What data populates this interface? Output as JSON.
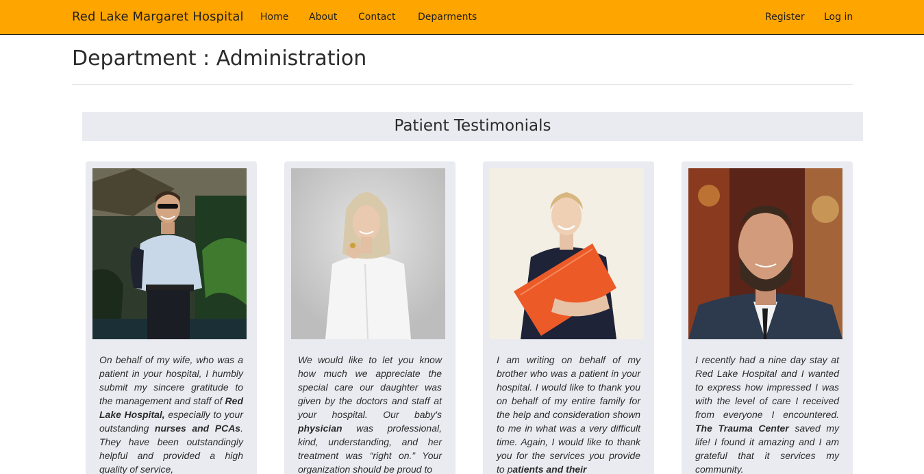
{
  "nav": {
    "brand": "Red Lake Margaret Hospital",
    "links": [
      "Home",
      "About",
      "Contact",
      "Deparments"
    ],
    "register": "Register",
    "login": "Log in"
  },
  "page": {
    "title": "Department : Administration"
  },
  "testimonials": {
    "heading": "Patient Testimonials",
    "cards": [
      {
        "parts": [
          "On behalf of my wife, who was a patient in your hospital, I humbly submit my sincere gratitude to the management and staff of ",
          "Red Lake Hospital,",
          " especially to your outstanding ",
          "nurses and PCAs",
          ". They have been outstandingly helpful and provided a high quality of service,"
        ]
      },
      {
        "parts": [
          "We would like to let you know how much we appreciate the special care our daughter was given by the doctors and staff at your hospital. Our baby's ",
          "physician",
          " was professional, kind, understanding, and her treatment was “right on.” Your organization should be proud to"
        ]
      },
      {
        "parts": [
          "I am writing on behalf of my brother who was a patient in your hospital. I would like to thank you on behalf of my entire family for the help and consideration shown to me in what was a very difficult time. Again, I would like to thank you for the services you provide to p",
          "atients and their"
        ]
      },
      {
        "parts": [
          "I recently had a nine day stay at Red Lake Hospital and I wanted to express how impressed I was with the level of care I received from everyone I encountered. ",
          "The Trauma Center",
          " saved my life! I found it amazing and I am grateful that it services my community."
        ]
      }
    ]
  },
  "colors": {
    "navbar": "#ffa500",
    "card_background": "#eaebf1",
    "text": "#2b2b2b"
  }
}
